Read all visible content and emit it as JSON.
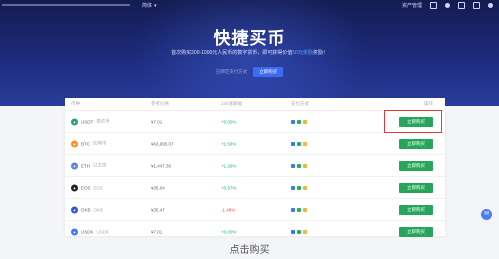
{
  "topnav": {
    "lang_label": "简体",
    "assets_label": "资产管理"
  },
  "hero": {
    "title": "快捷买币",
    "subtitle_pre": "首次购买200-1000元人民币的数字货币，即可获得价值",
    "subtitle_link": "50元奖励",
    "subtitle_post": "奖励！",
    "action_hint": "已绑定支付方式",
    "action_button": "立即购买"
  },
  "table": {
    "headers": [
      "币种",
      "参考价格",
      "24h涨跌幅",
      "支付方式",
      "操作"
    ],
    "rows": [
      {
        "symbol": "USDT",
        "name": "泰达币",
        "price": "¥7.01",
        "change": "+0.00%",
        "dir": "up",
        "icon_color": "#26a17b",
        "action": "立即购买"
      },
      {
        "symbol": "BTC",
        "name": "比特币",
        "price": "¥63,995.07",
        "change": "+1.56%",
        "dir": "up",
        "icon_color": "#f7931a",
        "action": "立即购买"
      },
      {
        "symbol": "ETH",
        "name": "以太坊",
        "price": "¥1,447.36",
        "change": "+1.26%",
        "dir": "up",
        "icon_color": "#627eea",
        "action": "立即购买"
      },
      {
        "symbol": "EOS",
        "name": "EOS",
        "price": "¥35.04",
        "change": "+0.57%",
        "dir": "up",
        "icon_color": "#222222",
        "action": "立即购买"
      },
      {
        "symbol": "OKB",
        "name": "OKB",
        "price": "¥35.47",
        "change": "-1.48%",
        "dir": "down",
        "icon_color": "#2d5bd6",
        "action": "立即购买"
      },
      {
        "symbol": "USDK",
        "name": "USDK",
        "price": "¥7.01",
        "change": "+0.00%",
        "dir": "up",
        "icon_color": "#3b7af0",
        "action": "立即购买"
      }
    ]
  },
  "caption": "点击购买",
  "colors": {
    "hero_top": "#141c52",
    "hero_bottom": "#2a3c9c",
    "buy_green": "#26a65b",
    "highlight_red": "#e03a3a",
    "up_green": "#19b36b",
    "down_red": "#e54848"
  }
}
